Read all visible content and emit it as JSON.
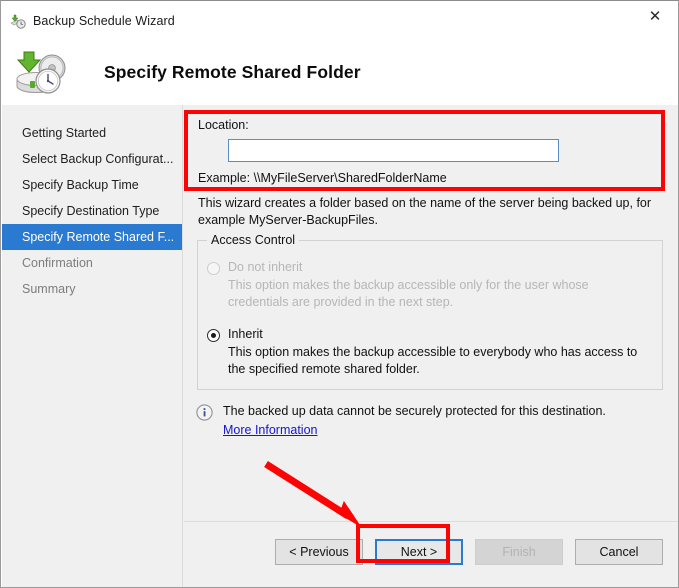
{
  "window": {
    "title": "Backup Schedule Wizard",
    "title_icon": "backup-schedule-icon",
    "close_label": "✕"
  },
  "header": {
    "title": "Specify Remote Shared Folder",
    "icon": "backup-disk-clock-icon"
  },
  "sidebar": {
    "items": [
      {
        "label": "Getting Started",
        "state": "normal"
      },
      {
        "label": "Select Backup Configurat...",
        "state": "normal"
      },
      {
        "label": "Specify Backup Time",
        "state": "normal"
      },
      {
        "label": "Specify Destination Type",
        "state": "normal"
      },
      {
        "label": "Specify Remote Shared F...",
        "state": "selected"
      },
      {
        "label": "Confirmation",
        "state": "dim"
      },
      {
        "label": "Summary",
        "state": "dim"
      }
    ]
  },
  "location": {
    "label": "Location:",
    "value": "",
    "placeholder": "",
    "example": "Example: \\\\MyFileServer\\SharedFolderName"
  },
  "description": "This wizard creates a folder based on the name of the server being backed up, for example MyServer-BackupFiles.",
  "access_control": {
    "legend": "Access Control",
    "options": [
      {
        "label": "Do not inherit",
        "description": "This option makes the backup accessible only for the user whose credentials are provided in the next step.",
        "selected": false,
        "disabled": true
      },
      {
        "label": "Inherit",
        "description": "This option makes the backup accessible to everybody who has access to the specified remote shared folder.",
        "selected": true,
        "disabled": false
      }
    ]
  },
  "info_note": {
    "icon": "information-icon",
    "text": "The backed up data cannot be securely protected for this destination.",
    "link_label": "More Information"
  },
  "footer": {
    "buttons": [
      {
        "label": "< Previous",
        "state": "normal"
      },
      {
        "label": "Next >",
        "state": "focused"
      },
      {
        "label": "Finish",
        "state": "disabled"
      },
      {
        "label": "Cancel",
        "state": "normal"
      }
    ]
  },
  "annotations": {
    "highlight_color": "#fc0404",
    "location_box": "red-rectangle-location",
    "next_box": "red-rectangle-next-button",
    "arrow": "red-arrow-pointing-to-next-button"
  },
  "colors": {
    "selection_blue": "#2a7ad2",
    "link_blue": "#1414d2",
    "panel_gray": "#f0f0f0",
    "button_gray": "#e3e3e3"
  }
}
